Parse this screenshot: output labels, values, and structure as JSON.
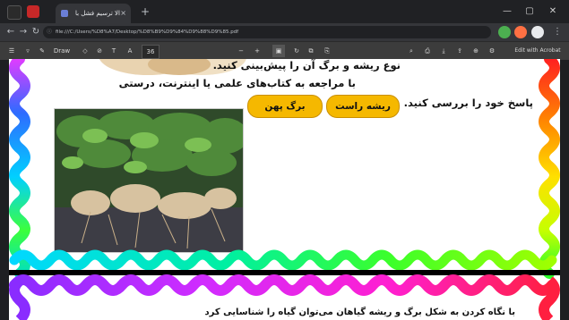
{
  "browser": {
    "tab_title": "الا ترسيم فشل با",
    "tab_close": "×",
    "new_tab": "+",
    "url": "file:///C:/Users/%D8%A7/Desktop/%D8%B9%D9%84%D9%88%D9%85.pdf",
    "acrobat_label": "Edit with Acrobat",
    "draw_label": "Draw",
    "page_number": "36",
    "zoom": "+"
  },
  "content": {
    "line1": "نوع ریشه و برگ آن را پیش‌بینی کنید.",
    "line2": "با مراجعه به کتاب‌های علمی یا اینترنت، درستی",
    "line3": "پاسخ خود را بررسی کنید.",
    "btn_root": "ریشه راست",
    "btn_leaf": "برگ پهن",
    "bottom_line": "با نگاه کردن به شکل برگ و ریشه گیاهان می‌توان گیاه را شناسایی کرد"
  },
  "colors": {
    "accent": "#f5b800"
  }
}
